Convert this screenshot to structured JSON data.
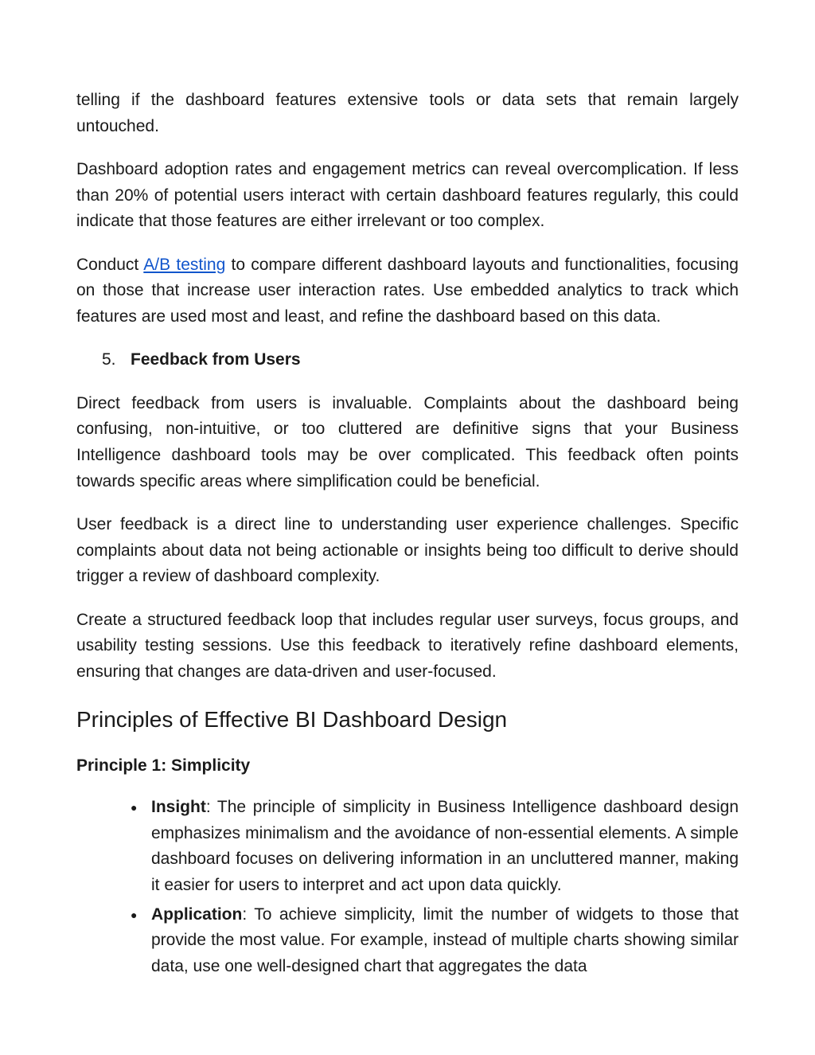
{
  "paragraphs": {
    "p1": "telling if the dashboard features extensive tools or data sets that remain largely untouched.",
    "p2": "Dashboard adoption rates and engagement metrics can reveal overcomplication. If less than 20% of potential users interact with certain dashboard features regularly, this could indicate that those features are either irrelevant or too complex.",
    "p3_pre": "Conduct ",
    "p3_link": "A/B testing",
    "p3_post": " to compare different dashboard layouts and functionalities, focusing on those that increase user interaction rates. Use embedded analytics to track which features are used most and least, and refine the dashboard based on this data.",
    "p4": "Direct feedback from users is invaluable. Complaints about the dashboard being confusing, non-intuitive, or too cluttered are definitive signs that your Business Intelligence dashboard tools may be over complicated. This feedback often points towards specific areas where simplification could be beneficial.",
    "p5": "User feedback is a direct line to understanding user experience challenges. Specific complaints about data not being actionable or insights being too difficult to derive should trigger a review of dashboard complexity.",
    "p6": "Create a structured feedback loop that includes regular user surveys, focus groups, and usability testing sessions. Use this feedback to iteratively refine dashboard elements, ensuring that changes are data-driven and user-focused."
  },
  "list_item_5": {
    "number": "5.",
    "label": "Feedback from Users"
  },
  "heading": "Principles of Effective BI Dashboard Design",
  "principle_1": {
    "title": "Principle 1: Simplicity",
    "insight_label": "Insight",
    "insight_text": ": The principle of simplicity in Business Intelligence dashboard design emphasizes minimalism and the avoidance of non-essential elements. A simple dashboard focuses on delivering information in an uncluttered manner, making it easier for users to interpret and act upon data quickly.",
    "application_label": "Application",
    "application_text": ": To achieve simplicity, limit the number of widgets to those that provide the most value. For example, instead of multiple charts showing similar data, use one well-designed chart that aggregates the data"
  }
}
